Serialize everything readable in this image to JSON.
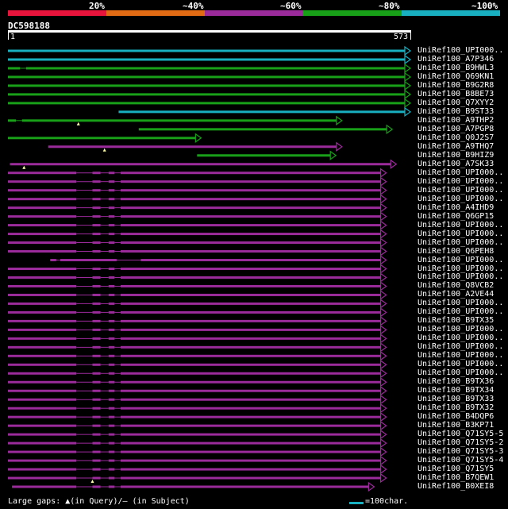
{
  "legend": {
    "labels": [
      "20%",
      "~40%",
      "~60%",
      "~80%",
      "~100%"
    ],
    "colors": [
      "#e8143c",
      "#e06b14",
      "#9b2a9b",
      "#18a018",
      "#18b0c0"
    ]
  },
  "query": {
    "name": "DC598188",
    "start": "1",
    "end": "573"
  },
  "hits": [
    {
      "label": "UniRef100_UPI000..",
      "color": "#18b0c0",
      "start": 0,
      "end": 1,
      "gaps": [],
      "marker": null
    },
    {
      "label": "UniRef100_A7P346",
      "color": "#18b0c0",
      "start": 0,
      "end": 1,
      "gaps": [],
      "marker": null
    },
    {
      "label": "UniRef100_B9HWL3",
      "color": "#18a018",
      "start": 0,
      "end": 1,
      "gaps": [
        [
          0.03,
          0.045
        ]
      ],
      "marker": null
    },
    {
      "label": "UniRef100_Q69KN1",
      "color": "#18a018",
      "start": 0,
      "end": 1,
      "gaps": [],
      "marker": null
    },
    {
      "label": "UniRef100_B9G2R8",
      "color": "#18a018",
      "start": 0,
      "end": 1,
      "gaps": [],
      "marker": null
    },
    {
      "label": "UniRef100_B8BE73",
      "color": "#18a018",
      "start": 0,
      "end": 1,
      "gaps": [],
      "marker": null
    },
    {
      "label": "UniRef100_Q7XYY2",
      "color": "#18a018",
      "start": 0,
      "end": 1,
      "gaps": [],
      "marker": null
    },
    {
      "label": "UniRef100_B9ST33",
      "color": "#18b0c0",
      "start": 0.275,
      "end": 1,
      "gaps": [],
      "marker": null
    },
    {
      "label": "UniRef100_A9THP2",
      "color": "#18a018",
      "start": 0,
      "end": 0.83,
      "gaps": [
        [
          0.02,
          0.035
        ]
      ],
      "marker": 0.175
    },
    {
      "label": "UniRef100_A7PGP8",
      "color": "#18a018",
      "start": 0.325,
      "end": 0.955,
      "gaps": [],
      "marker": null
    },
    {
      "label": "UniRef100_Q0J2S7",
      "color": "#18a018",
      "start": 0,
      "end": 0.48,
      "gaps": [],
      "marker": null
    },
    {
      "label": "UniRef100_A9THQ7",
      "color": "#9b2a9b",
      "start": 0.1,
      "end": 0.83,
      "gaps": [],
      "marker": 0.24
    },
    {
      "label": "UniRef100_B9HIZ9",
      "color": "#18a018",
      "start": 0.47,
      "end": 0.815,
      "gaps": [],
      "marker": null
    },
    {
      "label": "UniRef100_A7SK33",
      "color": "#9b2a9b",
      "start": 0.005,
      "end": 0.965,
      "gaps": [],
      "marker": 0.04
    },
    {
      "label": "UniRef100_UPI000..",
      "color": "#9b2a9b",
      "start": 0,
      "end": 0.94,
      "gaps": [
        [
          0.17,
          0.21
        ],
        [
          0.23,
          0.25
        ],
        [
          0.265,
          0.28
        ]
      ],
      "marker": null
    },
    {
      "label": "UniRef100_UPI000..",
      "color": "#9b2a9b",
      "start": 0,
      "end": 0.94,
      "gaps": [
        [
          0.17,
          0.21
        ],
        [
          0.23,
          0.25
        ],
        [
          0.265,
          0.28
        ]
      ],
      "marker": null
    },
    {
      "label": "UniRef100_UPI000..",
      "color": "#9b2a9b",
      "start": 0,
      "end": 0.94,
      "gaps": [
        [
          0.17,
          0.21
        ],
        [
          0.23,
          0.25
        ],
        [
          0.265,
          0.28
        ]
      ],
      "marker": null
    },
    {
      "label": "UniRef100_UPI000..",
      "color": "#9b2a9b",
      "start": 0,
      "end": 0.94,
      "gaps": [
        [
          0.17,
          0.21
        ],
        [
          0.23,
          0.25
        ],
        [
          0.265,
          0.28
        ]
      ],
      "marker": null
    },
    {
      "label": "UniRef100_A4IHD9",
      "color": "#9b2a9b",
      "start": 0,
      "end": 0.94,
      "gaps": [
        [
          0.17,
          0.21
        ],
        [
          0.23,
          0.25
        ],
        [
          0.265,
          0.28
        ]
      ],
      "marker": null
    },
    {
      "label": "UniRef100_Q6GP15",
      "color": "#9b2a9b",
      "start": 0,
      "end": 0.94,
      "gaps": [
        [
          0.17,
          0.21
        ],
        [
          0.23,
          0.25
        ],
        [
          0.265,
          0.28
        ]
      ],
      "marker": null
    },
    {
      "label": "UniRef100_UPI000..",
      "color": "#9b2a9b",
      "start": 0,
      "end": 0.94,
      "gaps": [
        [
          0.17,
          0.21
        ],
        [
          0.23,
          0.25
        ],
        [
          0.265,
          0.28
        ]
      ],
      "marker": null
    },
    {
      "label": "UniRef100_UPI000..",
      "color": "#9b2a9b",
      "start": 0,
      "end": 0.94,
      "gaps": [
        [
          0.17,
          0.21
        ],
        [
          0.23,
          0.25
        ],
        [
          0.265,
          0.28
        ]
      ],
      "marker": null
    },
    {
      "label": "UniRef100_UPI000..",
      "color": "#9b2a9b",
      "start": 0,
      "end": 0.94,
      "gaps": [
        [
          0.17,
          0.21
        ],
        [
          0.23,
          0.25
        ],
        [
          0.265,
          0.28
        ]
      ],
      "marker": null
    },
    {
      "label": "UniRef100_Q6PEH8",
      "color": "#9b2a9b",
      "start": 0,
      "end": 0.94,
      "gaps": [
        [
          0.17,
          0.21
        ],
        [
          0.23,
          0.25
        ],
        [
          0.265,
          0.28
        ]
      ],
      "marker": null
    },
    {
      "label": "UniRef100_UPI000..",
      "color": "#9b2a9b",
      "start": 0.105,
      "end": 0.94,
      "gaps": [
        [
          0.12,
          0.13
        ],
        [
          0.27,
          0.33
        ]
      ],
      "marker": null
    },
    {
      "label": "UniRef100_UPI000..",
      "color": "#9b2a9b",
      "start": 0,
      "end": 0.94,
      "gaps": [
        [
          0.17,
          0.21
        ],
        [
          0.23,
          0.25
        ],
        [
          0.265,
          0.28
        ]
      ],
      "marker": null
    },
    {
      "label": "UniRef100_UPI000..",
      "color": "#9b2a9b",
      "start": 0,
      "end": 0.94,
      "gaps": [
        [
          0.17,
          0.21
        ],
        [
          0.23,
          0.25
        ],
        [
          0.265,
          0.28
        ]
      ],
      "marker": null
    },
    {
      "label": "UniRef100_Q8VCB2",
      "color": "#9b2a9b",
      "start": 0,
      "end": 0.94,
      "gaps": [
        [
          0.17,
          0.21
        ],
        [
          0.23,
          0.25
        ],
        [
          0.265,
          0.28
        ]
      ],
      "marker": null
    },
    {
      "label": "UniRef100_A2VE44",
      "color": "#9b2a9b",
      "start": 0,
      "end": 0.94,
      "gaps": [
        [
          0.17,
          0.21
        ],
        [
          0.23,
          0.25
        ],
        [
          0.265,
          0.28
        ]
      ],
      "marker": null
    },
    {
      "label": "UniRef100_UPI000..",
      "color": "#9b2a9b",
      "start": 0,
      "end": 0.94,
      "gaps": [
        [
          0.17,
          0.21
        ],
        [
          0.23,
          0.25
        ],
        [
          0.265,
          0.28
        ]
      ],
      "marker": null
    },
    {
      "label": "UniRef100_UPI000..",
      "color": "#9b2a9b",
      "start": 0,
      "end": 0.94,
      "gaps": [
        [
          0.17,
          0.21
        ],
        [
          0.23,
          0.25
        ],
        [
          0.265,
          0.28
        ]
      ],
      "marker": null
    },
    {
      "label": "UniRef100_B9TX35",
      "color": "#9b2a9b",
      "start": 0,
      "end": 0.94,
      "gaps": [
        [
          0.17,
          0.21
        ],
        [
          0.23,
          0.25
        ],
        [
          0.265,
          0.28
        ]
      ],
      "marker": null
    },
    {
      "label": "UniRef100_UPI000..",
      "color": "#9b2a9b",
      "start": 0,
      "end": 0.94,
      "gaps": [
        [
          0.17,
          0.21
        ],
        [
          0.23,
          0.25
        ],
        [
          0.265,
          0.28
        ]
      ],
      "marker": null
    },
    {
      "label": "UniRef100_UPI000..",
      "color": "#9b2a9b",
      "start": 0,
      "end": 0.94,
      "gaps": [
        [
          0.17,
          0.21
        ],
        [
          0.23,
          0.25
        ],
        [
          0.265,
          0.28
        ]
      ],
      "marker": null
    },
    {
      "label": "UniRef100_UPI000..",
      "color": "#9b2a9b",
      "start": 0,
      "end": 0.94,
      "gaps": [
        [
          0.17,
          0.21
        ],
        [
          0.23,
          0.25
        ],
        [
          0.265,
          0.28
        ]
      ],
      "marker": null
    },
    {
      "label": "UniRef100_UPI000..",
      "color": "#9b2a9b",
      "start": 0,
      "end": 0.94,
      "gaps": [
        [
          0.17,
          0.21
        ],
        [
          0.23,
          0.25
        ],
        [
          0.265,
          0.28
        ]
      ],
      "marker": null
    },
    {
      "label": "UniRef100_UPI000..",
      "color": "#9b2a9b",
      "start": 0,
      "end": 0.94,
      "gaps": [
        [
          0.17,
          0.21
        ],
        [
          0.23,
          0.25
        ],
        [
          0.265,
          0.28
        ]
      ],
      "marker": null
    },
    {
      "label": "UniRef100_UPI000..",
      "color": "#9b2a9b",
      "start": 0,
      "end": 0.94,
      "gaps": [
        [
          0.17,
          0.21
        ],
        [
          0.23,
          0.25
        ],
        [
          0.265,
          0.28
        ]
      ],
      "marker": null
    },
    {
      "label": "UniRef100_B9TX36",
      "color": "#9b2a9b",
      "start": 0,
      "end": 0.94,
      "gaps": [
        [
          0.17,
          0.21
        ],
        [
          0.23,
          0.25
        ],
        [
          0.265,
          0.28
        ]
      ],
      "marker": null
    },
    {
      "label": "UniRef100_B9TX34",
      "color": "#9b2a9b",
      "start": 0,
      "end": 0.94,
      "gaps": [
        [
          0.17,
          0.21
        ],
        [
          0.23,
          0.25
        ],
        [
          0.265,
          0.28
        ]
      ],
      "marker": null
    },
    {
      "label": "UniRef100_B9TX33",
      "color": "#9b2a9b",
      "start": 0,
      "end": 0.94,
      "gaps": [
        [
          0.17,
          0.21
        ],
        [
          0.23,
          0.25
        ],
        [
          0.265,
          0.28
        ]
      ],
      "marker": null
    },
    {
      "label": "UniRef100_B9TX32",
      "color": "#9b2a9b",
      "start": 0,
      "end": 0.94,
      "gaps": [
        [
          0.17,
          0.21
        ],
        [
          0.23,
          0.25
        ],
        [
          0.265,
          0.28
        ]
      ],
      "marker": null
    },
    {
      "label": "UniRef100_B4DQP6",
      "color": "#9b2a9b",
      "start": 0,
      "end": 0.94,
      "gaps": [
        [
          0.17,
          0.21
        ],
        [
          0.23,
          0.25
        ],
        [
          0.265,
          0.28
        ]
      ],
      "marker": null
    },
    {
      "label": "UniRef100_B3KP71",
      "color": "#9b2a9b",
      "start": 0,
      "end": 0.94,
      "gaps": [
        [
          0.17,
          0.21
        ],
        [
          0.23,
          0.25
        ],
        [
          0.265,
          0.28
        ]
      ],
      "marker": null
    },
    {
      "label": "UniRef100_Q71SY5-5",
      "color": "#9b2a9b",
      "start": 0,
      "end": 0.94,
      "gaps": [
        [
          0.17,
          0.21
        ],
        [
          0.23,
          0.25
        ],
        [
          0.265,
          0.28
        ]
      ],
      "marker": null
    },
    {
      "label": "UniRef100_Q71SY5-2",
      "color": "#9b2a9b",
      "start": 0,
      "end": 0.94,
      "gaps": [
        [
          0.17,
          0.21
        ],
        [
          0.23,
          0.25
        ],
        [
          0.265,
          0.28
        ]
      ],
      "marker": null
    },
    {
      "label": "UniRef100_Q71SY5-3",
      "color": "#9b2a9b",
      "start": 0,
      "end": 0.94,
      "gaps": [
        [
          0.17,
          0.21
        ],
        [
          0.23,
          0.25
        ],
        [
          0.265,
          0.28
        ]
      ],
      "marker": null
    },
    {
      "label": "UniRef100_Q71SY5-4",
      "color": "#9b2a9b",
      "start": 0,
      "end": 0.94,
      "gaps": [
        [
          0.17,
          0.21
        ],
        [
          0.23,
          0.25
        ],
        [
          0.265,
          0.28
        ]
      ],
      "marker": null
    },
    {
      "label": "UniRef100_Q71SY5",
      "color": "#9b2a9b",
      "start": 0,
      "end": 0.94,
      "gaps": [
        [
          0.17,
          0.21
        ],
        [
          0.23,
          0.25
        ],
        [
          0.265,
          0.28
        ]
      ],
      "marker": null
    },
    {
      "label": "UniRef100_B7QEW1",
      "color": "#9b2a9b",
      "start": 0,
      "end": 0.94,
      "gaps": [
        [
          0.17,
          0.21
        ],
        [
          0.23,
          0.25
        ],
        [
          0.265,
          0.28
        ]
      ],
      "marker": 0.21
    },
    {
      "label": "UniRef100_B0XEI8",
      "color": "#9b2a9b",
      "start": 0.01,
      "end": 0.91,
      "gaps": [
        [
          0.17,
          0.21
        ],
        [
          0.23,
          0.25
        ],
        [
          0.265,
          0.28
        ]
      ],
      "marker": null
    }
  ],
  "footer": {
    "note": "Large gaps: ▲(in Query)/– (in Subject)",
    "scale_label": "=100char.",
    "scale_color": "#18b0c0"
  }
}
